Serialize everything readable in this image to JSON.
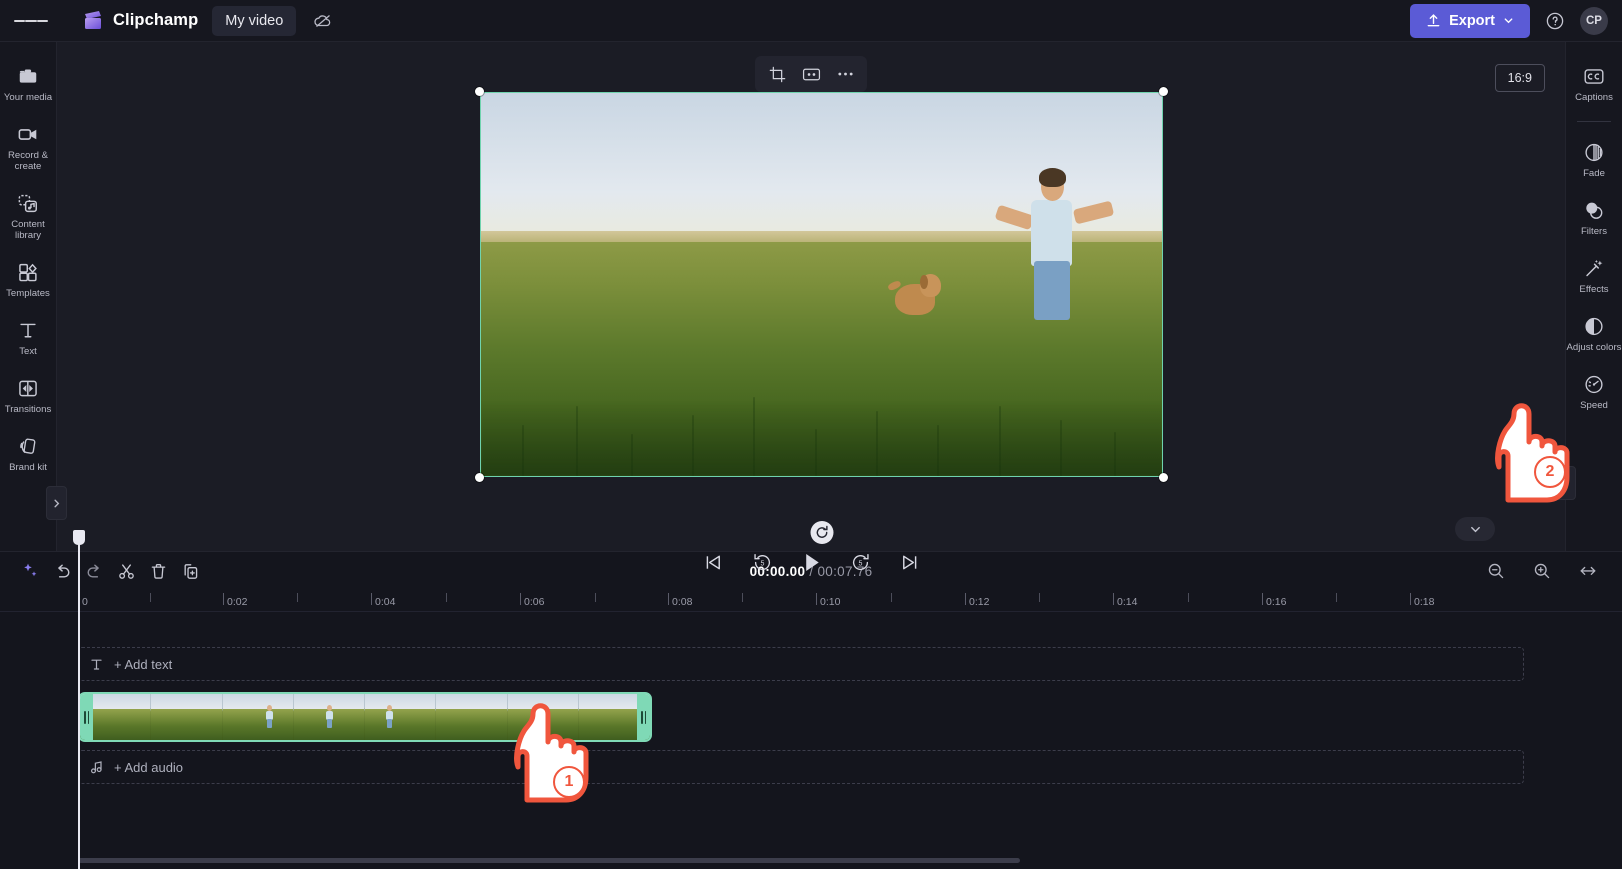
{
  "topbar": {
    "menu_icon": "hamburger-icon",
    "brand": "Clipchamp",
    "project_title": "My video",
    "cloud_icon": "cloud-off-icon",
    "export_label": "Export",
    "export_color": "#5b5bd6",
    "help_icon": "help-circle-icon",
    "avatar_initials": "CP"
  },
  "left_rail": {
    "items": [
      {
        "label": "Your media",
        "icon": "folder-icon"
      },
      {
        "label": "Record & create",
        "icon": "video-camera-icon"
      },
      {
        "label": "Content library",
        "icon": "content-library-icon"
      },
      {
        "label": "Templates",
        "icon": "templates-grid-icon"
      },
      {
        "label": "Text",
        "icon": "text-t-icon"
      },
      {
        "label": "Transitions",
        "icon": "transitions-icon"
      },
      {
        "label": "Brand kit",
        "icon": "brand-kit-icon"
      }
    ],
    "collapse_icon": "chevron-right-icon"
  },
  "stage": {
    "float_tools": [
      {
        "name": "crop",
        "icon": "crop-icon"
      },
      {
        "name": "transform",
        "icon": "keyframe-box-icon"
      },
      {
        "name": "more",
        "icon": "ellipsis-icon"
      }
    ],
    "aspect_ratio": "16:9",
    "rotate_icon": "rotate-clockwise-icon",
    "captions_toggle_icon": "captions-off-icon",
    "fullscreen_icon": "fullscreen-icon",
    "transport": [
      {
        "name": "skip-to-start",
        "icon": "skip-back-icon"
      },
      {
        "name": "rewind-5s",
        "icon": "rewind-5-icon"
      },
      {
        "name": "play",
        "icon": "play-icon"
      },
      {
        "name": "forward-5s",
        "icon": "forward-5-icon"
      },
      {
        "name": "skip-to-end",
        "icon": "skip-forward-icon"
      }
    ]
  },
  "right_rail": {
    "items": [
      {
        "label": "Captions",
        "icon": "closed-captions-icon"
      },
      {
        "label": "Fade",
        "icon": "fade-icon"
      },
      {
        "label": "Filters",
        "icon": "filters-circles-icon"
      },
      {
        "label": "Effects",
        "icon": "effects-wand-icon"
      },
      {
        "label": "Adjust colors",
        "icon": "adjust-colors-icon"
      },
      {
        "label": "Speed",
        "icon": "speedometer-icon"
      }
    ],
    "collapse_icon": "chevron-left-icon",
    "expand_down_icon": "chevron-down-icon"
  },
  "timeline": {
    "toolbar": [
      {
        "name": "ai-suggest",
        "icon": "sparkle-icon"
      },
      {
        "name": "undo",
        "icon": "undo-arrow-icon"
      },
      {
        "name": "redo",
        "icon": "redo-arrow-icon"
      },
      {
        "name": "split",
        "icon": "scissors-icon"
      },
      {
        "name": "delete",
        "icon": "trash-icon"
      },
      {
        "name": "duplicate",
        "icon": "duplicate-icon"
      }
    ],
    "current_time": "00:00.00",
    "separator": "/",
    "total_time": "00:07.76",
    "zoom_controls": [
      {
        "name": "zoom-out",
        "icon": "magnifier-minus-icon"
      },
      {
        "name": "zoom-in",
        "icon": "magnifier-plus-icon"
      },
      {
        "name": "fit-to-window",
        "icon": "fit-arrows-icon"
      }
    ],
    "ruler_labels": [
      "0",
      "0:02",
      "0:04",
      "0:06",
      "0:08",
      "0:10",
      "0:12",
      "0:14",
      "0:16",
      "0:18"
    ],
    "text_track_label": "+ Add text",
    "text_track_icon": "text-t-icon",
    "audio_track_label": "+ Add audio",
    "audio_track_icon": "music-note-icon",
    "clip_border_color": "#7fd9b6",
    "clip_start_time": "0",
    "clip_end_time": "00:07.76"
  },
  "annotations": {
    "cursor_color": "#f0563d",
    "steps": [
      {
        "number": "1",
        "target": "video-clip-on-timeline"
      },
      {
        "number": "2",
        "target": "speed-tool-right-rail"
      }
    ]
  }
}
